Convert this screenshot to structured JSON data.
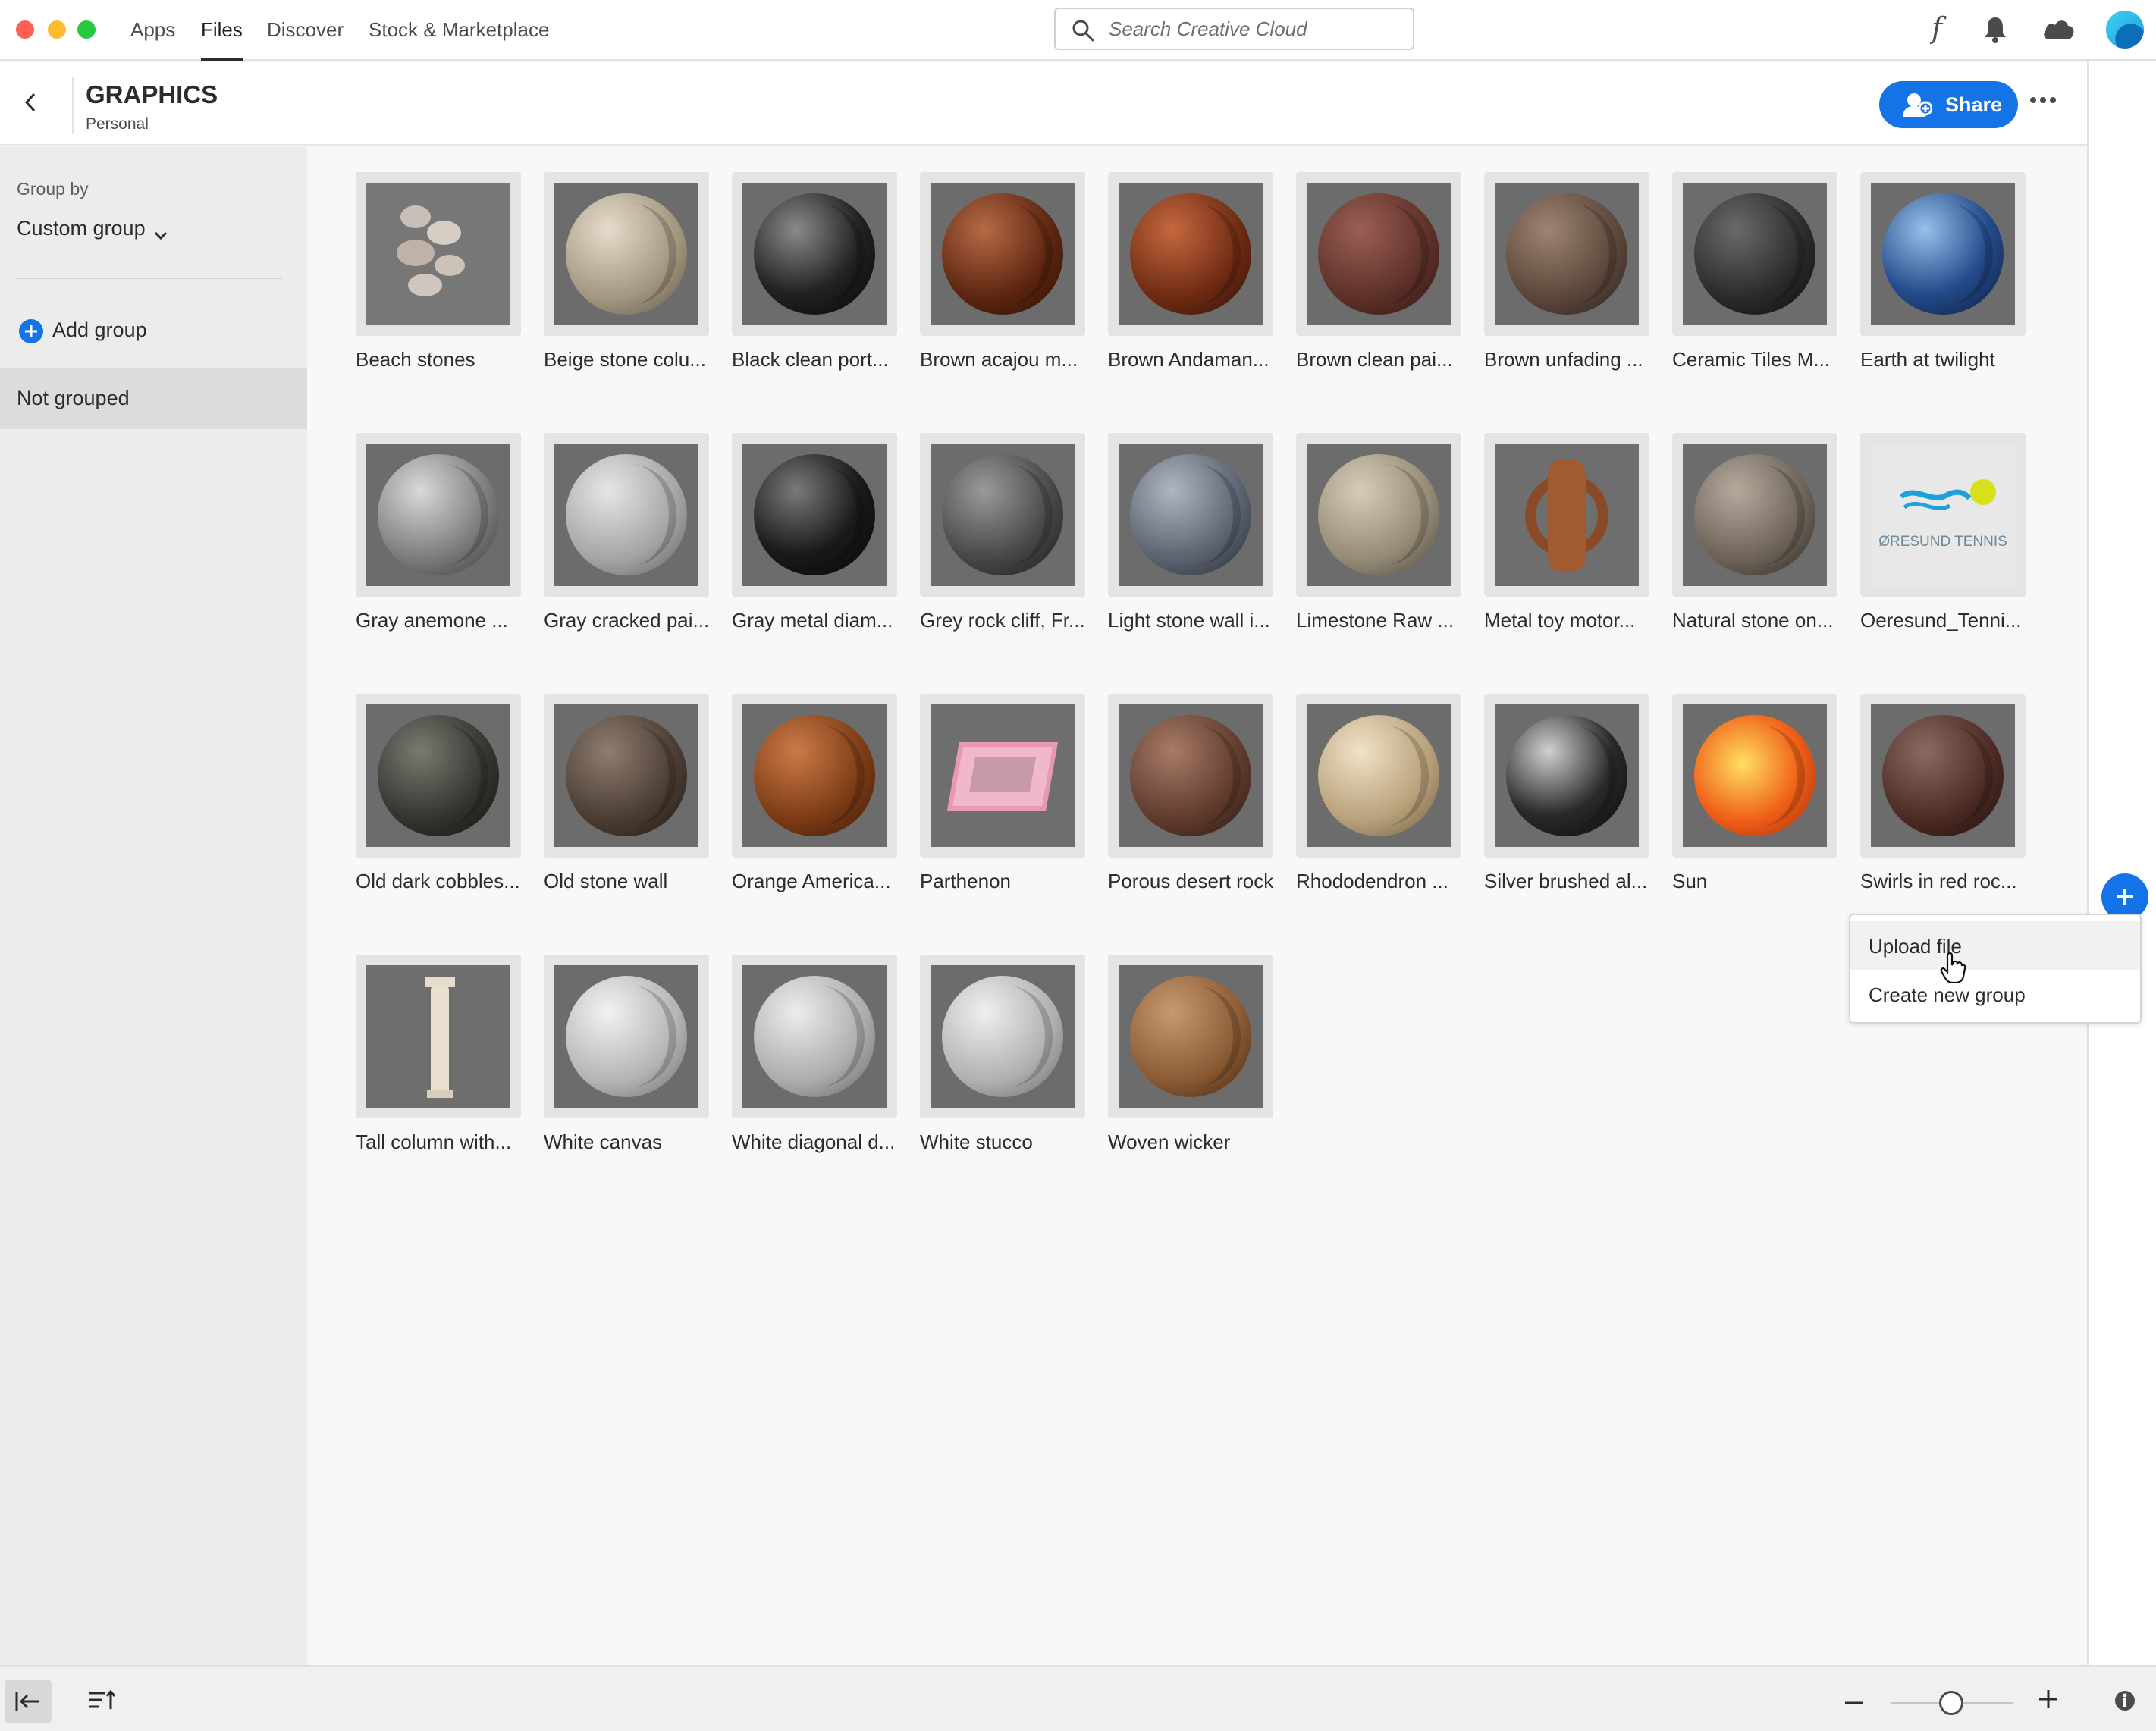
{
  "nav": {
    "tabs": [
      "Apps",
      "Files",
      "Discover",
      "Stock & Marketplace"
    ],
    "active_tab": "Files",
    "search_placeholder": "Search Creative Cloud"
  },
  "header": {
    "title": "GRAPHICS",
    "subtitle": "Personal",
    "share_label": "Share"
  },
  "sidebar": {
    "group_by_label": "Group by",
    "group_by_value": "Custom group",
    "add_group_label": "Add group",
    "not_grouped_label": "Not grouped"
  },
  "files": [
    {
      "name": "Beach stones",
      "thumb": "stones"
    },
    {
      "name": "Beige stone colu...",
      "thumb": "beige-stone"
    },
    {
      "name": "Black clean port...",
      "thumb": "black-marble"
    },
    {
      "name": "Brown acajou m...",
      "thumb": "brown-wood"
    },
    {
      "name": "Brown Andaman...",
      "thumb": "brown-wood-red"
    },
    {
      "name": "Brown clean pai...",
      "thumb": "brown-matte"
    },
    {
      "name": "Brown unfading ...",
      "thumb": "brown-stone"
    },
    {
      "name": "Ceramic Tiles M...",
      "thumb": "dark-ceramic"
    },
    {
      "name": "Earth at twilight",
      "thumb": "earth"
    },
    {
      "name": "Gray anemone ...",
      "thumb": "gray-granite"
    },
    {
      "name": "Gray cracked pai...",
      "thumb": "light-gray"
    },
    {
      "name": "Gray metal diam...",
      "thumb": "black-metal"
    },
    {
      "name": "Grey rock cliff, Fr...",
      "thumb": "grey-rock"
    },
    {
      "name": "Light stone wall i...",
      "thumb": "blue-stone"
    },
    {
      "name": "Limestone Raw ...",
      "thumb": "limestone"
    },
    {
      "name": "Metal toy motor...",
      "thumb": "motorbike"
    },
    {
      "name": "Natural stone on...",
      "thumb": "natural-stone"
    },
    {
      "name": "Oeresund_Tenni...",
      "thumb": "tennis-logo"
    },
    {
      "name": "Old dark cobbles...",
      "thumb": "cobbles"
    },
    {
      "name": "Old stone wall",
      "thumb": "stone-wall"
    },
    {
      "name": "Orange America...",
      "thumb": "orange-wood"
    },
    {
      "name": "Parthenon",
      "thumb": "parthenon"
    },
    {
      "name": "Porous desert rock",
      "thumb": "desert-rock"
    },
    {
      "name": "Rhododendron ...",
      "thumb": "rhododendron"
    },
    {
      "name": "Silver brushed al...",
      "thumb": "silver"
    },
    {
      "name": "Sun",
      "thumb": "sun"
    },
    {
      "name": "Swirls in red roc...",
      "thumb": "red-rock"
    },
    {
      "name": "Tall column with...",
      "thumb": "column"
    },
    {
      "name": "White canvas",
      "thumb": "white-canvas"
    },
    {
      "name": "White diagonal d...",
      "thumb": "white-diagonal"
    },
    {
      "name": "White stucco",
      "thumb": "white-stucco"
    },
    {
      "name": "Woven wicker",
      "thumb": "wicker"
    }
  ],
  "logo_text": "ØRESUND TENNIS",
  "add_menu": {
    "items": [
      "Upload file",
      "Create new group"
    ]
  },
  "colors": {
    "accent": "#1473e6",
    "sidebar_bg": "#ececec",
    "selected_bg": "#dcdcdc"
  }
}
